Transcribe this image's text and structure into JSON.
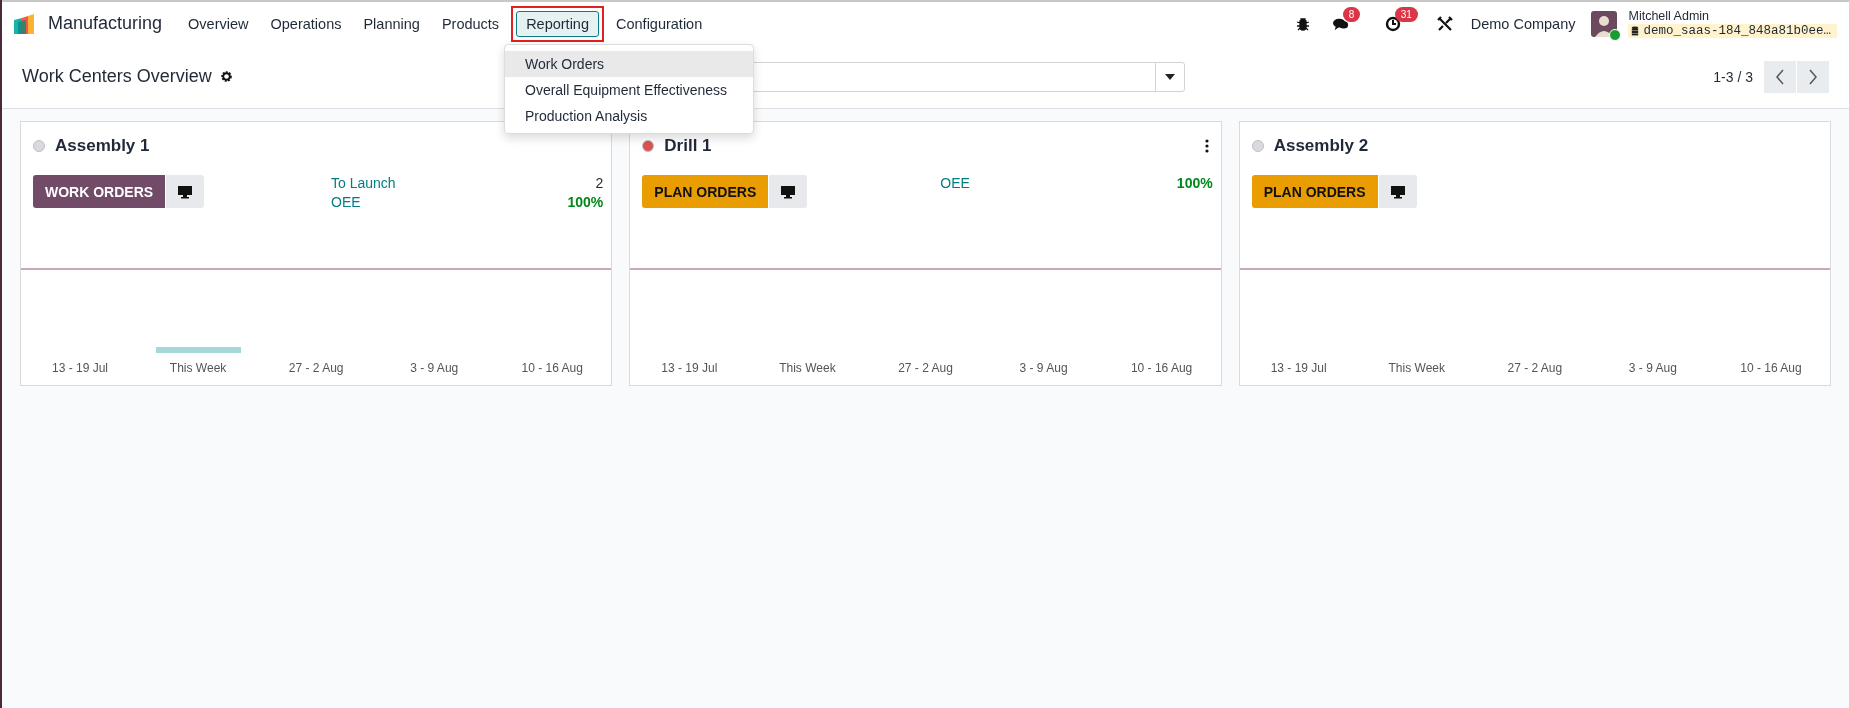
{
  "navbar": {
    "app_name": "Manufacturing",
    "menu": [
      {
        "label": "Overview",
        "selected": false
      },
      {
        "label": "Operations",
        "selected": false
      },
      {
        "label": "Planning",
        "selected": false
      },
      {
        "label": "Products",
        "selected": false
      },
      {
        "label": "Reporting",
        "selected": true
      },
      {
        "label": "Configuration",
        "selected": false
      }
    ],
    "messages_count": "8",
    "activities_count": "31",
    "company": "Demo Company",
    "user_name": "Mitchell Admin",
    "database": "demo_saas-184_848a81b0ee…"
  },
  "dropdown": {
    "items": [
      {
        "label": "Work Orders",
        "selected": true
      },
      {
        "label": "Overall Equipment Effectiveness",
        "selected": false
      },
      {
        "label": "Production Analysis",
        "selected": false
      }
    ]
  },
  "control_panel": {
    "title": "Work Centers Overview",
    "pager": "1-3 / 3"
  },
  "cards": [
    {
      "name": "Assembly 1",
      "color": "#d9d9de",
      "menu": false,
      "action": {
        "label": "WORK ORDERS",
        "kind": "primary"
      },
      "stats": [
        {
          "label": "To Launch",
          "value": "2",
          "kind": "count"
        },
        {
          "label": "OEE",
          "value": "100%",
          "kind": "good"
        }
      ],
      "weeks": [
        {
          "label": "13 - 19 Jul",
          "bar": false
        },
        {
          "label": "This Week",
          "bar": true
        },
        {
          "label": "27 - 2 Aug",
          "bar": false
        },
        {
          "label": "3 - 9 Aug",
          "bar": false
        },
        {
          "label": "10 - 16 Aug",
          "bar": false
        }
      ]
    },
    {
      "name": "Drill 1",
      "color": "#d9534f",
      "menu": true,
      "action": {
        "label": "PLAN ORDERS",
        "kind": "warning"
      },
      "stats": [
        {
          "label": "OEE",
          "value": "100%",
          "kind": "good"
        }
      ],
      "weeks": [
        {
          "label": "13 - 19 Jul",
          "bar": false
        },
        {
          "label": "This Week",
          "bar": false
        },
        {
          "label": "27 - 2 Aug",
          "bar": false
        },
        {
          "label": "3 - 9 Aug",
          "bar": false
        },
        {
          "label": "10 - 16 Aug",
          "bar": false
        }
      ]
    },
    {
      "name": "Assembly 2",
      "color": "#d9d9de",
      "menu": false,
      "action": {
        "label": "PLAN ORDERS",
        "kind": "warning"
      },
      "weeks": [
        {
          "label": "13 - 19 Jul",
          "bar": false
        },
        {
          "label": "This Week",
          "bar": false
        },
        {
          "label": "27 - 2 Aug",
          "bar": false
        },
        {
          "label": "3 - 9 Aug",
          "bar": false
        },
        {
          "label": "10 - 16 Aug",
          "bar": false
        }
      ]
    }
  ]
}
